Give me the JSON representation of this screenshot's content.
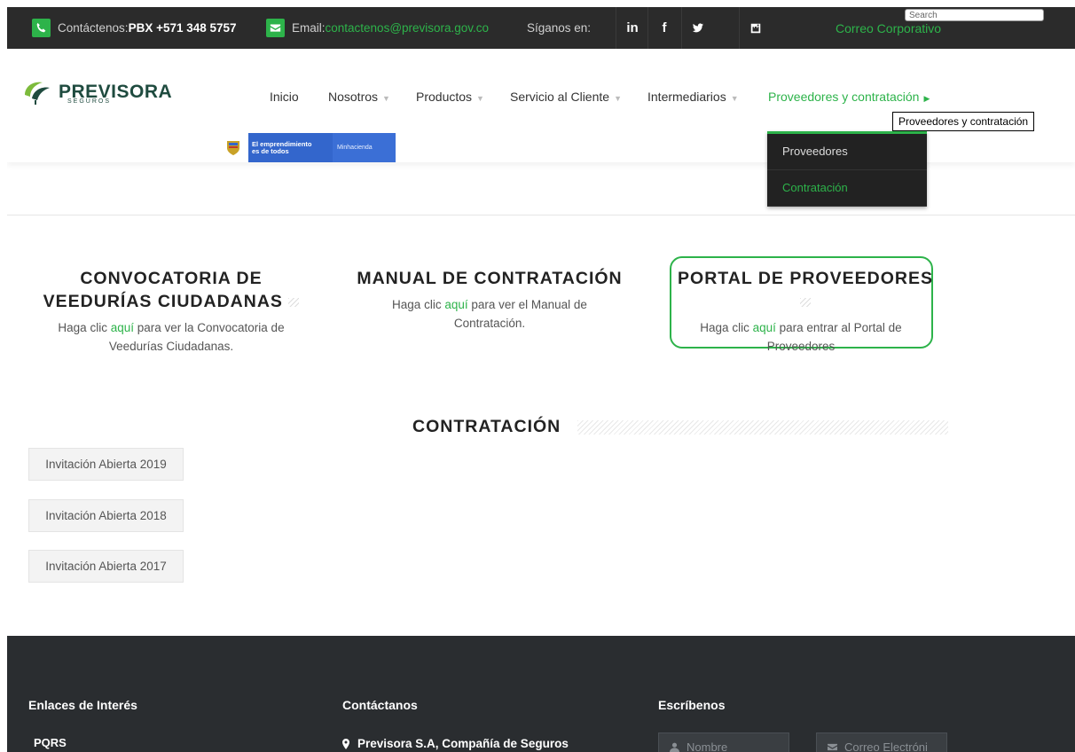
{
  "topbar": {
    "contact_prefix": "Contáctenos: ",
    "contact_phone": "PBX +571 348 5757",
    "email_prefix": "Email: ",
    "email_address": "contactenos@previsora.gov.co",
    "follow_label": "Síganos en:",
    "social": [
      "linkedin-icon",
      "facebook-icon",
      "twitter-icon",
      "instagram-icon"
    ],
    "search_placeholder": "Search",
    "correo_label": "Correo Corporativo"
  },
  "logo": {
    "name": "PREVISORA",
    "tagline": "SEGUROS"
  },
  "nav": {
    "items": [
      {
        "label": "Inicio",
        "has_caret": false
      },
      {
        "label": "Nosotros",
        "has_caret": true
      },
      {
        "label": "Productos",
        "has_caret": true
      },
      {
        "label": "Servicio al Cliente",
        "has_caret": true
      },
      {
        "label": "Intermediarios",
        "has_caret": true
      },
      {
        "label": "Proveedores y contratación",
        "has_caret": true,
        "active": true
      }
    ],
    "tooltip": "Proveedores y contratación",
    "dropdown": [
      "Proveedores",
      "Contratación"
    ]
  },
  "gov_banner": {
    "text_line1": "El emprendimiento",
    "text_line2": "es de todos",
    "ministry": "Minhacienda"
  },
  "features": [
    {
      "title": "CONVOCATORIA DE VEEDURÍAS CIUDADANAS",
      "text_before": "Haga clic ",
      "link": "aquí",
      "text_after": " para ver la Convocatoria de Veedurías Ciudadanas."
    },
    {
      "title": "MANUAL DE CONTRATACIÓN",
      "text_before": "Haga clic ",
      "link": "aquí",
      "text_after": " para ver el Manual de Contratación."
    },
    {
      "title": "PORTAL DE PROVEEDORES",
      "text_before": "Haga clic ",
      "link": "aquí",
      "text_after": " para entrar al Portal de Proveedores"
    }
  ],
  "contratacion": {
    "title": "CONTRATACIÓN",
    "buttons": [
      "Invitación Abierta 2019",
      "Invitación Abierta 2018",
      "Invitación Abierta 2017"
    ]
  },
  "footer": {
    "col1_title": "Enlaces de Interés",
    "col1_link": "PQRS",
    "col2_title": "Contáctanos",
    "col2_address": "Previsora S.A, Compañía de Seguros",
    "col3_title": "Escríbenos",
    "name_placeholder": "Nombre",
    "email_placeholder": "Correo Electróni"
  },
  "colors": {
    "accent": "#2db34a",
    "topbar": "#2b2b2b",
    "footer": "#2a2d30"
  }
}
